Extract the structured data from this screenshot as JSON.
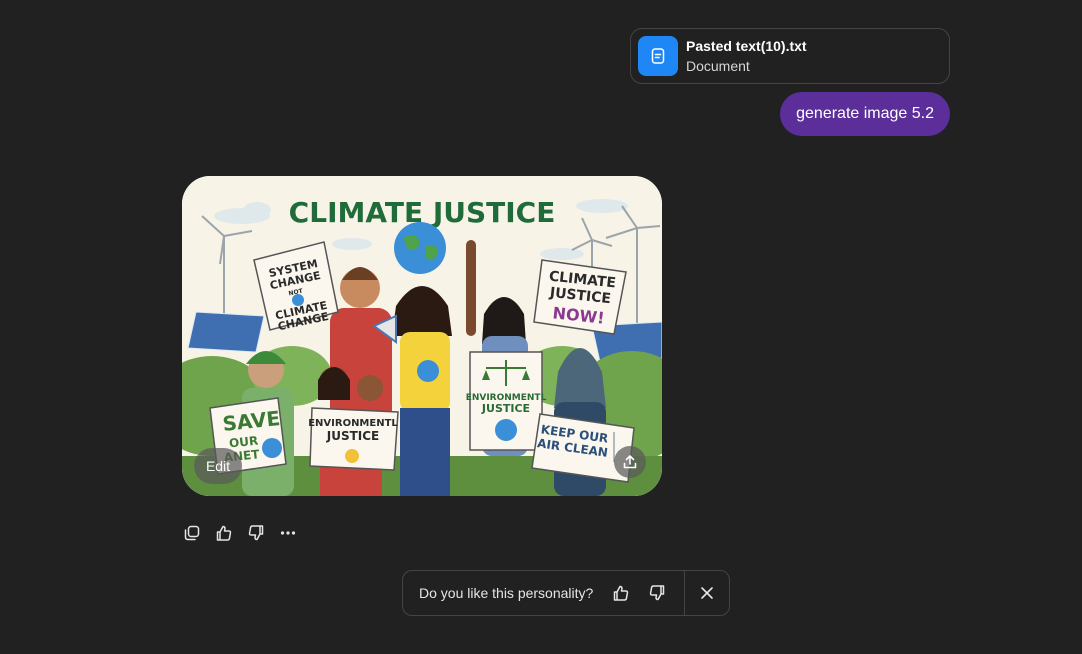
{
  "attachment": {
    "file_name": "Pasted text(10).txt",
    "file_type": "Document",
    "icon": "document-icon",
    "accent_color": "#1e86f5"
  },
  "user_message": {
    "text": "generate image 5.2",
    "bubble_color": "#5b2e9a"
  },
  "generated_image": {
    "title": "CLIMATE JUSTICE",
    "signs": {
      "system_change": [
        "SYSTEM",
        "CHANGE",
        "NOT",
        "CLIMATE",
        "CHANGE"
      ],
      "climate_justice_now": [
        "CLIMATE",
        "JUSTICE",
        "NOW!"
      ],
      "save_our_planet": [
        "SAVE",
        "OUR",
        "ANET"
      ],
      "environmentl_justice_small": [
        "ENVIRONMENTL",
        "JUSTICE"
      ],
      "environmentl_justice_scales": [
        "ENVIRONMENTL",
        "JUSTICE"
      ],
      "keep_our_air_clean": [
        "KEEP OUR",
        "AIR CLEAN"
      ]
    },
    "edit_label": "Edit",
    "share_icon": "share-upload-icon"
  },
  "actions": [
    {
      "name": "copy-button",
      "icon": "copy-icon"
    },
    {
      "name": "thumbs-up-button",
      "icon": "thumbs-up-icon"
    },
    {
      "name": "thumbs-down-button",
      "icon": "thumbs-down-icon"
    },
    {
      "name": "more-options-button",
      "icon": "ellipsis-icon"
    }
  ],
  "feedback": {
    "question": "Do you like this personality?",
    "like_icon": "thumbs-up-icon",
    "dislike_icon": "thumbs-down-icon",
    "close_icon": "close-icon"
  },
  "colors": {
    "background": "#212121",
    "border": "#444444",
    "title_green": "#1f6b3a"
  }
}
